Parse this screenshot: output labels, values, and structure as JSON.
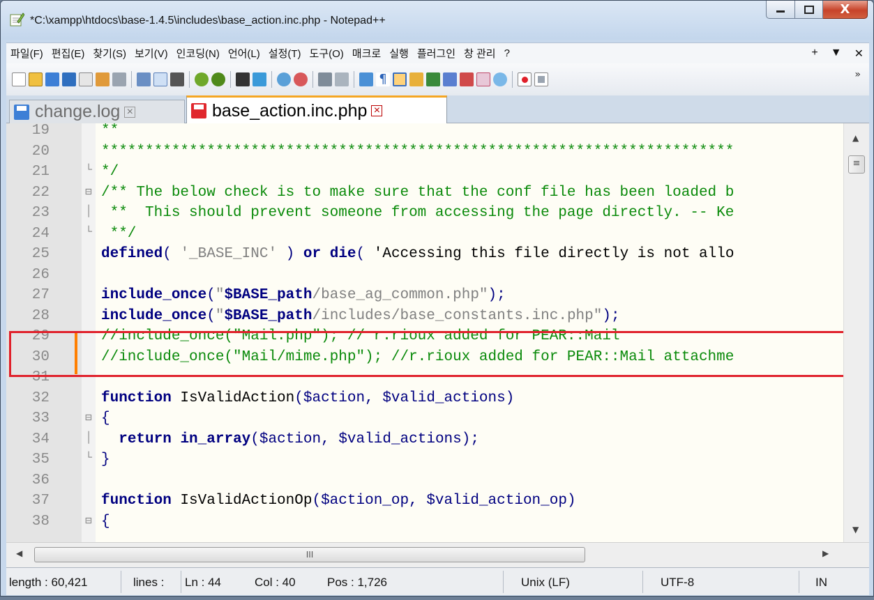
{
  "window": {
    "title": "*C:\\xampp\\htdocs\\base-1.4.5\\includes\\base_action.inc.php - Notepad++",
    "minimize_label": "–",
    "maximize_label": "☐",
    "close_label": "X"
  },
  "menu": {
    "items": [
      "파일(F)",
      "편집(E)",
      "찾기(S)",
      "보기(V)",
      "인코딩(N)",
      "언어(L)",
      "설정(T)",
      "도구(O)",
      "매크로",
      "실행",
      "플러그인",
      "창 관리",
      "?"
    ],
    "right": [
      "+",
      "▼",
      "✕"
    ]
  },
  "toolbar": {
    "more": "»"
  },
  "tabs": [
    {
      "label": "change.log",
      "active": false
    },
    {
      "label": "base_action.inc.php",
      "active": true
    }
  ],
  "editor": {
    "lines": [
      {
        "num": "19",
        "fold": "",
        "text": "**"
      },
      {
        "num": "20",
        "fold": "",
        "text": "************************************************************************"
      },
      {
        "num": "21",
        "fold": "└",
        "text": "*/"
      },
      {
        "num": "22",
        "fold": "⊟",
        "text": "/** The below check is to make sure that the conf file has been loaded b"
      },
      {
        "num": "23",
        "fold": "│",
        "text": " **  This should prevent someone from accessing the page directly. -- Ke"
      },
      {
        "num": "24",
        "fold": "└",
        "text": " **/"
      },
      {
        "num": "25",
        "fold": "",
        "text": "defined( '_BASE_INC' ) or die( 'Accessing this file directly is not allo"
      },
      {
        "num": "26",
        "fold": "",
        "text": ""
      },
      {
        "num": "27",
        "fold": "",
        "text": "include_once(\"$BASE_path/base_ag_common.php\");"
      },
      {
        "num": "28",
        "fold": "",
        "text": "include_once(\"$BASE_path/includes/base_constants.inc.php\");"
      },
      {
        "num": "29",
        "fold": "",
        "text": "//include_once(\"Mail.php\"); // r.rioux added for PEAR::Mail"
      },
      {
        "num": "30",
        "fold": "",
        "text": "//include_once(\"Mail/mime.php\"); //r.rioux added for PEAR::Mail attachme"
      },
      {
        "num": "31",
        "fold": "",
        "text": ""
      },
      {
        "num": "32",
        "fold": "",
        "text": "function IsValidAction($action, $valid_actions)"
      },
      {
        "num": "33",
        "fold": "⊟",
        "text": "{"
      },
      {
        "num": "34",
        "fold": "│",
        "text": "  return in_array($action, $valid_actions);"
      },
      {
        "num": "35",
        "fold": "└",
        "text": "}"
      },
      {
        "num": "36",
        "fold": "",
        "text": ""
      },
      {
        "num": "37",
        "fold": "",
        "text": "function IsValidActionOp($action_op, $valid_action_op)"
      },
      {
        "num": "38",
        "fold": "⊟",
        "text": "{"
      }
    ]
  },
  "scroll": {
    "thumb_grip": "III"
  },
  "status": {
    "length": "length : 60,421",
    "lines": "lines :",
    "ln": "Ln : 44",
    "col": "Col : 40",
    "pos": "Pos : 1,726",
    "eol": "Unix (LF)",
    "encoding": "UTF-8",
    "mode": "IN"
  },
  "colors": {
    "highlight_box": "#e0202a",
    "change_marker": "#ff7f00",
    "active_tab_accent": "#f5a623",
    "comment": "#0a8a0a",
    "keyword": "#000080"
  }
}
